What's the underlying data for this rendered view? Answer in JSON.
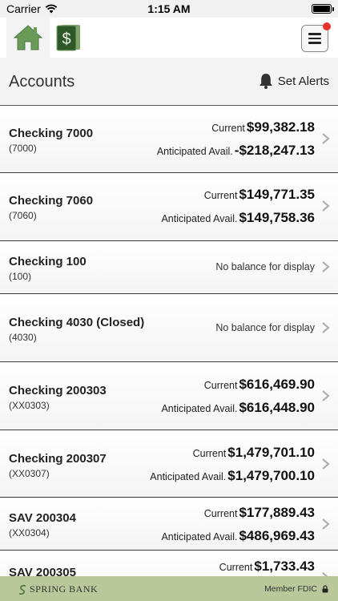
{
  "status_bar": {
    "carrier": "Carrier",
    "time": "1:15 AM"
  },
  "nav": {
    "home_icon": "home-icon",
    "money_icon": "dollar-icon",
    "menu_icon": "hamburger-icon"
  },
  "header": {
    "title": "Accounts",
    "alerts_label": "Set Alerts"
  },
  "labels": {
    "current": "Current",
    "anticipated": "Anticipated Avail.",
    "no_balance": "No balance for display"
  },
  "accounts": [
    {
      "name": "Checking 7000",
      "number": "(7000)",
      "current": "$99,382.18",
      "anticipated": "-$218,247.13"
    },
    {
      "name": "Checking 7060",
      "number": "(7060)",
      "current": "$149,771.35",
      "anticipated": "$149,758.36"
    },
    {
      "name": "Checking 100",
      "number": "(100)",
      "no_balance": "No balance for display"
    },
    {
      "name": "Checking 4030 (Closed)",
      "number": "(4030)",
      "no_balance": "No balance for display"
    },
    {
      "name": "Checking 200303",
      "number": "(XX0303)",
      "current": "$616,469.90",
      "anticipated": "$616,448.90"
    },
    {
      "name": "Checking 200307",
      "number": "(XX0307)",
      "current": "$1,479,701.10",
      "anticipated": "$1,479,700.10"
    },
    {
      "name": "SAV 200304",
      "number": "(XX0304)",
      "current": "$177,889.43",
      "anticipated": "$486,969.43"
    },
    {
      "name": "SAV 200305",
      "number": "",
      "current": "$1,733.43",
      "anticipated": ""
    }
  ],
  "footer": {
    "brand": "SPRING BANK",
    "fdic": "Member FDIC"
  },
  "colors": {
    "nav_green": "#5a8a4a",
    "footer_bg": "#b9c79a",
    "badge_red": "#e8332b"
  }
}
